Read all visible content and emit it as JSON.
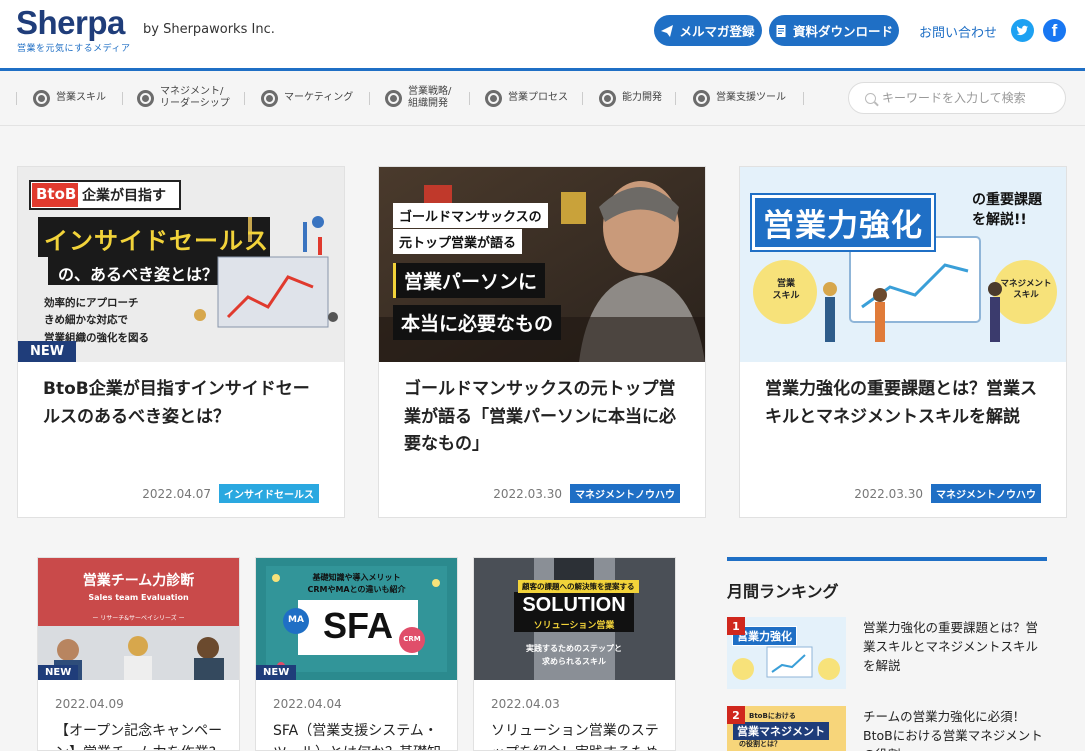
{
  "header": {
    "logo": "Sherpa",
    "tagline": "営業を元気にするメディア",
    "by": "by Sherpaworks Inc.",
    "newsletter_btn": "メルマガ登録",
    "download_btn": "資料ダウンロード",
    "contact": "お問い合わせ"
  },
  "nav": {
    "items": [
      {
        "label": "営業スキル",
        "icon": "handshake-icon"
      },
      {
        "label": "マネジメント/\nリーダーシップ",
        "icon": "people-icon"
      },
      {
        "label": "マーケティング",
        "icon": "target-icon"
      },
      {
        "label": "営業戦略/\n組織開発",
        "icon": "globe-icon"
      },
      {
        "label": "営業プロセス",
        "icon": "chart-icon"
      },
      {
        "label": "能力開発",
        "icon": "growth-icon"
      },
      {
        "label": "営業支援ツール",
        "icon": "cloud-icon"
      }
    ],
    "search_placeholder": "キーワードを入力して検索"
  },
  "featured": [
    {
      "title": "BtoB企業が目指すインサイドセールスのあるべき姿とは？",
      "date": "2022.04.07",
      "tag": "インサイドセールス",
      "badge": "NEW",
      "image": {
        "ribbon": "BtoB企業が目指す",
        "headline1": "インサイドセールス",
        "headline2": "の、あるべき姿とは？",
        "sub1": "効率的にアプローチ",
        "sub2": "きめ細かな対応で",
        "sub3": "営業組織の強化を図る"
      }
    },
    {
      "title": "ゴールドマンサックスの元トップ営業が語る「営業パーソンに本当に必要なもの」",
      "date": "2022.03.30",
      "tag": "マネジメントノウハウ",
      "image": {
        "line1": "ゴールドマンサックスの",
        "line2": "元トップ営業が語る",
        "line3": "営業パーソンに",
        "line4": "本当に必要なもの"
      }
    },
    {
      "title": "営業力強化の重要課題とは？営業スキルとマネジメントスキルを解説",
      "date": "2022.03.30",
      "tag": "マネジメントノウハウ",
      "image": {
        "headline": "営業力強化",
        "sub1": "の重要課題",
        "sub2": "を解説!!",
        "bubble1": "営業\nスキル",
        "bubble2": "マネジメント\nスキル"
      }
    }
  ],
  "latest": [
    {
      "date": "2022.04.09",
      "title": "【オープン記念キャンペーン】営業チーム力を作業?",
      "badge": "NEW",
      "image": {
        "headline": "営業チーム力診断",
        "sub": "Sales team Evaluation",
        "series": "ー リサーチ&サーベイシリーズ ー"
      }
    },
    {
      "date": "2022.04.04",
      "title": "SFA（営業支援システム・ツール）とは何か？基礎知",
      "badge": "NEW",
      "image": {
        "line1": "基礎知識や導入メリット",
        "line2": "CRMやMAとの違いも紹介",
        "headline": "SFA",
        "left": "MA",
        "right": "CRM"
      }
    },
    {
      "date": "2022.04.03",
      "title": "ソリューション営業のステップを紹介！実践するため",
      "image": {
        "top": "顧客の課題への解決策を提案する",
        "headline": "SOLUTION",
        "sub": "ソリューション営業",
        "bottom1": "実践するためのステップと",
        "bottom2": "求められるスキル"
      }
    }
  ],
  "ranking": {
    "heading": "月間ランキング",
    "items": [
      {
        "rank": "1",
        "title": "営業力強化の重要課題とは？営業スキルとマネジメントスキルを解説",
        "thumb_text": "営業力強化"
      },
      {
        "rank": "2",
        "title": "チームの営業力強化に必須！BtoBにおける営業マネジメントの役割",
        "thumb_text": "営業マネジメント",
        "thumb_sub": "BtoBにおける",
        "thumb_sub2": "の役割とは？"
      }
    ]
  },
  "colors": {
    "brand": "#1f6fc5",
    "navy": "#1f3d7a",
    "rank": "#d0271d"
  }
}
